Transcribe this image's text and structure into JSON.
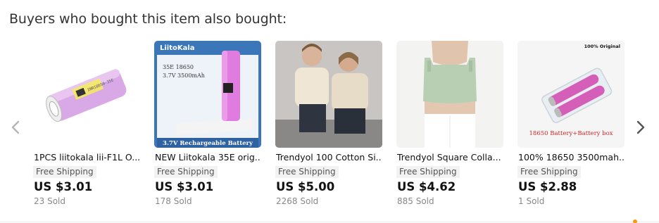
{
  "section_title": "Buyers who bought this item also bought:",
  "icons": {
    "prev": "chevron-left-icon",
    "next": "chevron-right-icon"
  },
  "products": [
    {
      "title": "1PCS liitokala lii-F1L O...",
      "shipping": "Free Shipping",
      "price": "US $3.01",
      "sold": "23 Sold",
      "image": {
        "battery_label": "INR18650-35E"
      }
    },
    {
      "title": "NEW Liitokala 35E orig...",
      "shipping": "Free Shipping",
      "price": "US $3.01",
      "sold": "178 Sold",
      "image": {
        "brand": "LiitoKala",
        "model_line1": "35E  18650",
        "model_line2": "3.7V  3500mAh",
        "banner": "3.7V Rechargeable Battery"
      }
    },
    {
      "title": "Trendyol 100 Cotton Si...",
      "shipping": "Free Shipping",
      "price": "US $5.00",
      "sold": "2268 Sold"
    },
    {
      "title": "Trendyol Square Colla...",
      "shipping": "Free Shipping",
      "price": "US $4.62",
      "sold": "885 Sold"
    },
    {
      "title": "100% 18650 3500mah...",
      "shipping": "Free Shipping",
      "price": "US $2.88",
      "sold": "1 Sold",
      "image": {
        "badge": "100% Original",
        "caption": "18650 Battery+Battery box"
      }
    }
  ],
  "colors": {
    "accent_indicator": "#f39c12",
    "battery_pink": "#e07be0",
    "liitokala_blue": "#3a76b8"
  }
}
